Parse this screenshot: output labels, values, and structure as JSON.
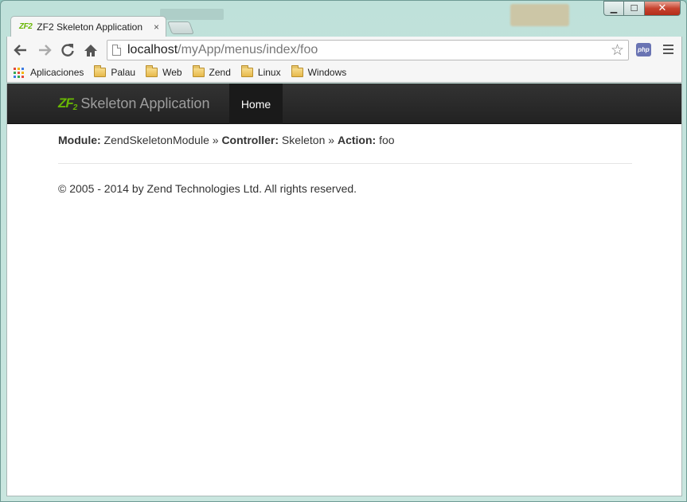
{
  "window": {
    "caption_minimize": "▁",
    "caption_maximize": "☐",
    "caption_close": "✕"
  },
  "tab": {
    "favicon_text": "ZF2",
    "title": "ZF2 Skeleton Application",
    "close": "×"
  },
  "toolbar": {
    "back_icon": "arrow-left-icon",
    "forward_icon": "arrow-right-icon",
    "reload_icon": "reload-icon",
    "home_icon": "home-icon",
    "url_host": "localhost",
    "url_path": "/myApp/menus/index/foo",
    "star": "☆",
    "extension_label": "php"
  },
  "bookmarks": {
    "apps_label": "Aplicaciones",
    "folders": [
      "Palau",
      "Web",
      "Zend",
      "Linux",
      "Windows"
    ]
  },
  "page": {
    "brand_logo": "ZF",
    "brand_logo_sub": "2",
    "brand_name": "Skeleton Application",
    "nav_home": "Home",
    "route": {
      "module_label": "Module:",
      "module_value": "ZendSkeletonModule",
      "sep1": "»",
      "controller_label": "Controller:",
      "controller_value": "Skeleton",
      "sep2": "»",
      "action_label": "Action:",
      "action_value": "foo"
    },
    "footer": "© 2005 - 2014 by Zend Technologies Ltd. All rights reserved."
  },
  "colors": {
    "zf_green": "#68b604",
    "navbar_bg": "#222222",
    "desktop": "#a9d4cb"
  }
}
